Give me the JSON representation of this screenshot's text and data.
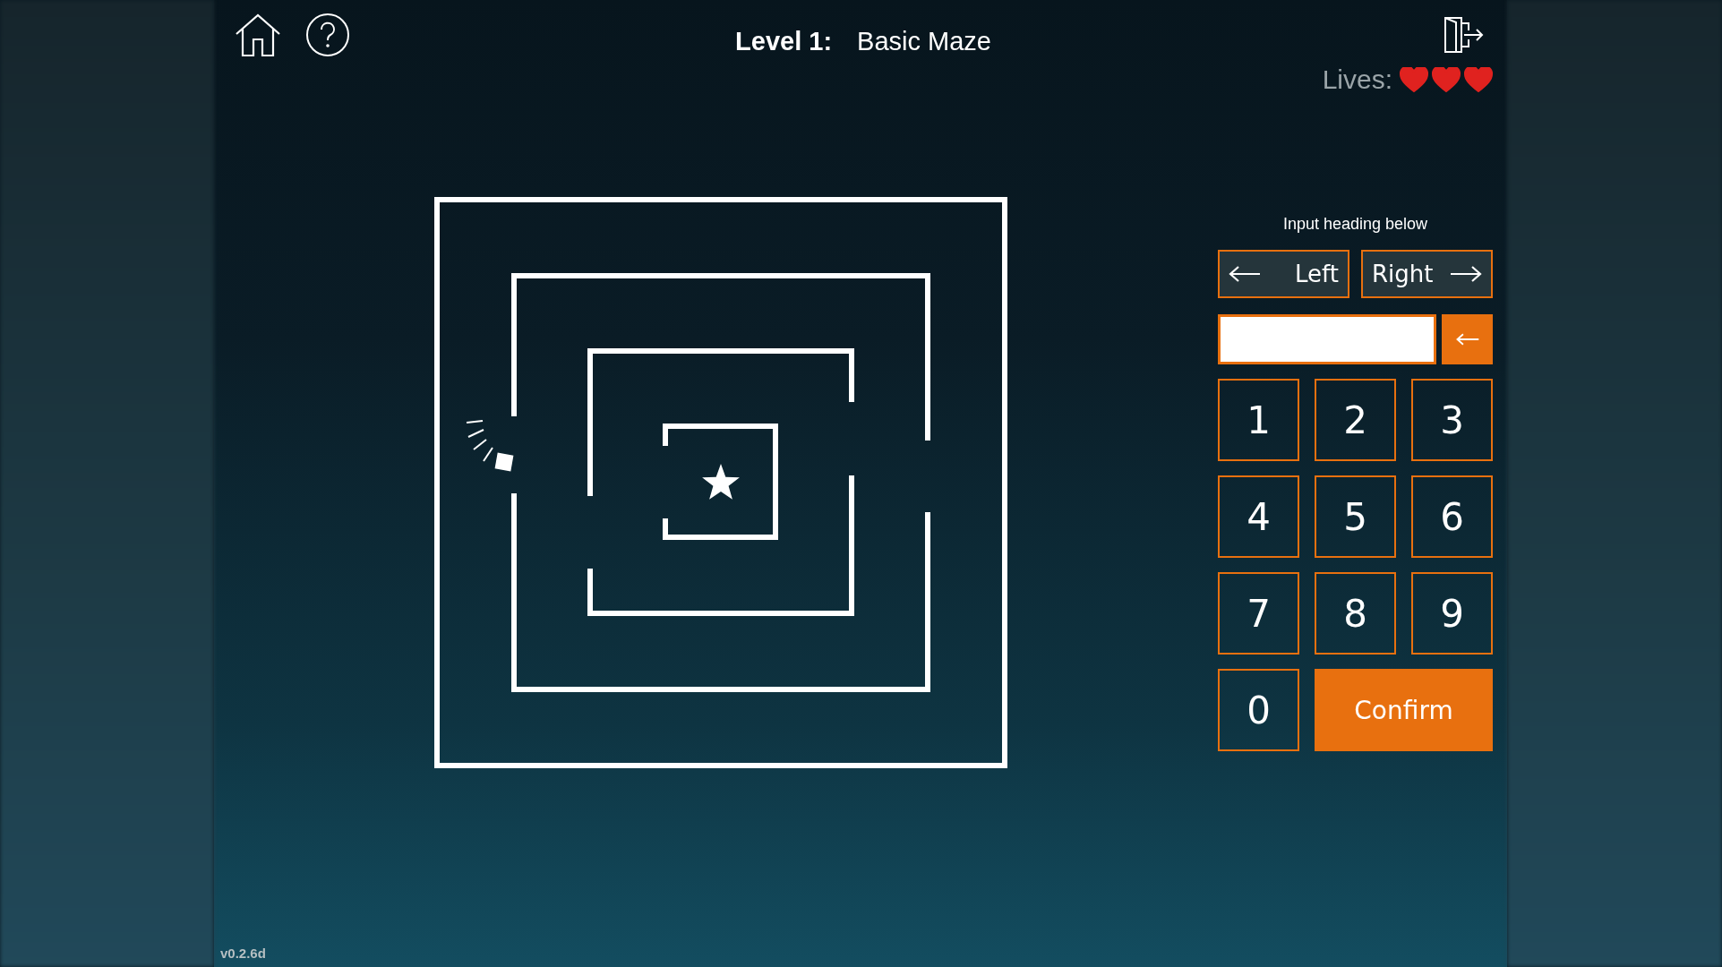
{
  "header": {
    "title_label": "Level 1:",
    "title_name": "Basic Maze",
    "lives_label": "Lives:",
    "hearts": [
      {
        "filled": true
      },
      {
        "filled": true
      },
      {
        "filled": true
      }
    ]
  },
  "panel": {
    "heading": "Input heading below",
    "turn_buttons": [
      {
        "label": "Left",
        "kind": "left"
      },
      {
        "label": "Right",
        "kind": "right"
      }
    ],
    "keys": [
      "1",
      "2",
      "3",
      "4",
      "5",
      "6",
      "7",
      "8",
      "9",
      "0"
    ],
    "confirm": "Confirm"
  },
  "version": "v0.2.6d"
}
